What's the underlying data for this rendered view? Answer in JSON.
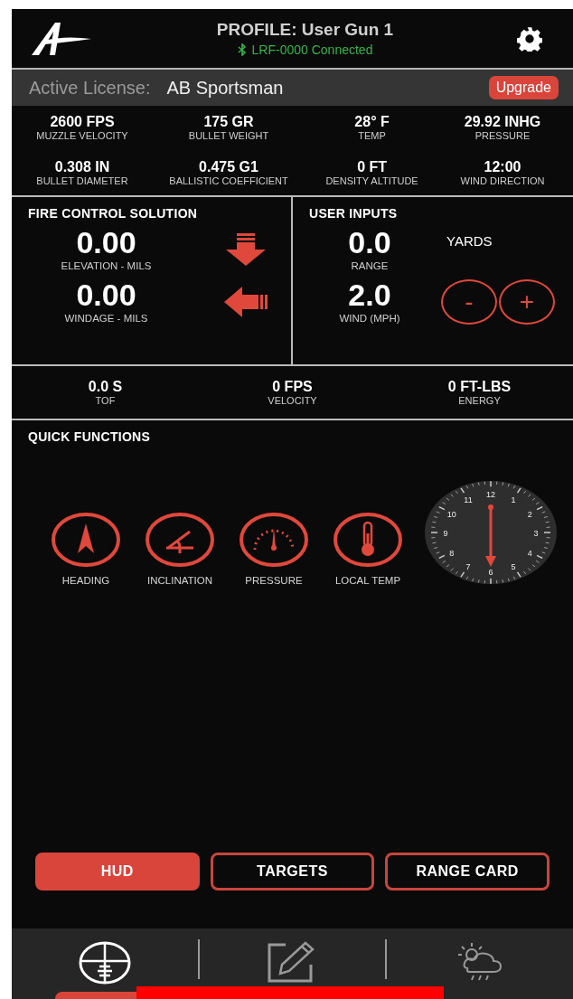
{
  "header": {
    "title": "PROFILE: User Gun 1",
    "device_status": "LRF-0000 Connected",
    "connected": true
  },
  "license": {
    "label": "Active License:",
    "value": "AB Sportsman",
    "upgrade_button": "Upgrade"
  },
  "stats": [
    {
      "value": "2600 FPS",
      "label": "MUZZLE VELOCITY"
    },
    {
      "value": "175 GR",
      "label": "BULLET WEIGHT"
    },
    {
      "value": "28° F",
      "label": "TEMP"
    },
    {
      "value": "29.92 INHG",
      "label": "PRESSURE"
    },
    {
      "value": "0.308 IN",
      "label": "BULLET DIAMETER"
    },
    {
      "value": "0.475 G1",
      "label": "BALLISTIC COEFFICIENT"
    },
    {
      "value": "0 FT",
      "label": "DENSITY ALTITUDE"
    },
    {
      "value": "12:00",
      "label": "WIND DIRECTION"
    }
  ],
  "fire_control": {
    "title": "FIRE CONTROL SOLUTION",
    "rows": [
      {
        "kind": "elevation",
        "value": "0.00",
        "label": "ELEVATION - MILS"
      },
      {
        "kind": "windage",
        "value": "0.00",
        "label": "WINDAGE - MILS"
      }
    ]
  },
  "user_inputs": {
    "title": "USER INPUTS",
    "range": {
      "value": "0.0",
      "label": "RANGE",
      "unit": "YARDS"
    },
    "wind": {
      "value": "2.0",
      "label": "WIND (MPH)"
    },
    "decrement_button": "-",
    "increment_button": "+"
  },
  "results": [
    {
      "value": "0.0 S",
      "label": "TOF"
    },
    {
      "value": "0 FPS",
      "label": "VELOCITY"
    },
    {
      "value": "0 FT-LBS",
      "label": "ENERGY"
    }
  ],
  "quick_functions": {
    "title": "QUICK FUNCTIONS",
    "items": [
      {
        "kind": "heading",
        "label": "HEADING"
      },
      {
        "kind": "inclination",
        "label": "INCLINATION"
      },
      {
        "kind": "pressure",
        "label": "PRESSURE"
      },
      {
        "kind": "temp",
        "label": "LOCAL TEMP"
      }
    ],
    "wind_clock": {
      "hours": [
        "12",
        "1",
        "2",
        "3",
        "4",
        "5",
        "6",
        "7",
        "8",
        "9",
        "10",
        "11"
      ]
    }
  },
  "mode_buttons": [
    {
      "label": "HUD",
      "selected": true
    },
    {
      "label": "TARGETS",
      "selected": false
    },
    {
      "label": "RANGE CARD",
      "selected": false
    }
  ],
  "nav": [
    {
      "kind": "scope",
      "selected": true
    },
    {
      "kind": "edit",
      "selected": false
    },
    {
      "kind": "weather",
      "selected": false
    }
  ]
}
